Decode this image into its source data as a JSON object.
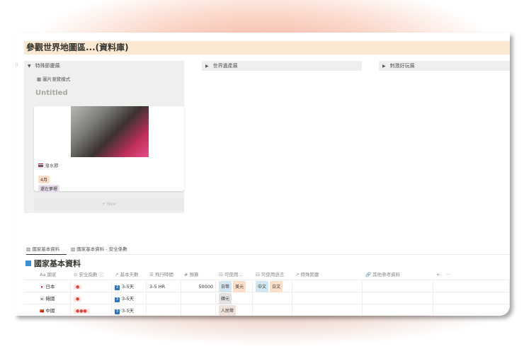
{
  "page": {
    "title": "參觀世界地圖區...(資料庫)"
  },
  "toggles": [
    {
      "label": "特殊節慶展",
      "expanded": true
    },
    {
      "label": "世界遺產展",
      "expanded": false
    },
    {
      "label": "刺激好玩展",
      "expanded": false
    }
  ],
  "gallery": {
    "view_label": "圖片瀏覽模式",
    "heading": "Untitled",
    "card": {
      "name": "潑水節",
      "tags": [
        "4月",
        "還在夢裡"
      ]
    },
    "new_label": "+ New"
  },
  "tabs": [
    "國家基本資料",
    "國家基本資料 - 安全係數"
  ],
  "database": {
    "title": "國家基本資料",
    "columns": [
      "Aa 國家",
      "⊙ 安全指數 ⓘ",
      "↗ 基本天數",
      "☰ 飛行時間",
      "# 預算",
      "☷ 可使用...",
      "☷ 可使用語言",
      "↗ 特殊節慶",
      "🔗 其他參考資料",
      "+",
      "···"
    ],
    "rows": [
      {
        "flag": "🇯🇵",
        "country": "日本",
        "safety": "●",
        "days": "3-5天",
        "days_num": "3",
        "flight": "3-5 HR",
        "budget": "50000",
        "currency": [
          "日幣",
          "美元"
        ],
        "languages": [
          "中文",
          "日文"
        ]
      },
      {
        "flag": "🇰🇷",
        "country": "韓國",
        "safety": "●",
        "days": "3-5天",
        "days_num": "3",
        "flight": "",
        "budget": "",
        "currency": [
          "韓元"
        ],
        "languages": []
      },
      {
        "flag": "🇨🇳",
        "country": "中國",
        "safety": "●●●",
        "days": "3-5天",
        "days_num": "3",
        "flight": "",
        "budget": "",
        "currency": [
          "人民幣"
        ],
        "languages": []
      }
    ]
  }
}
